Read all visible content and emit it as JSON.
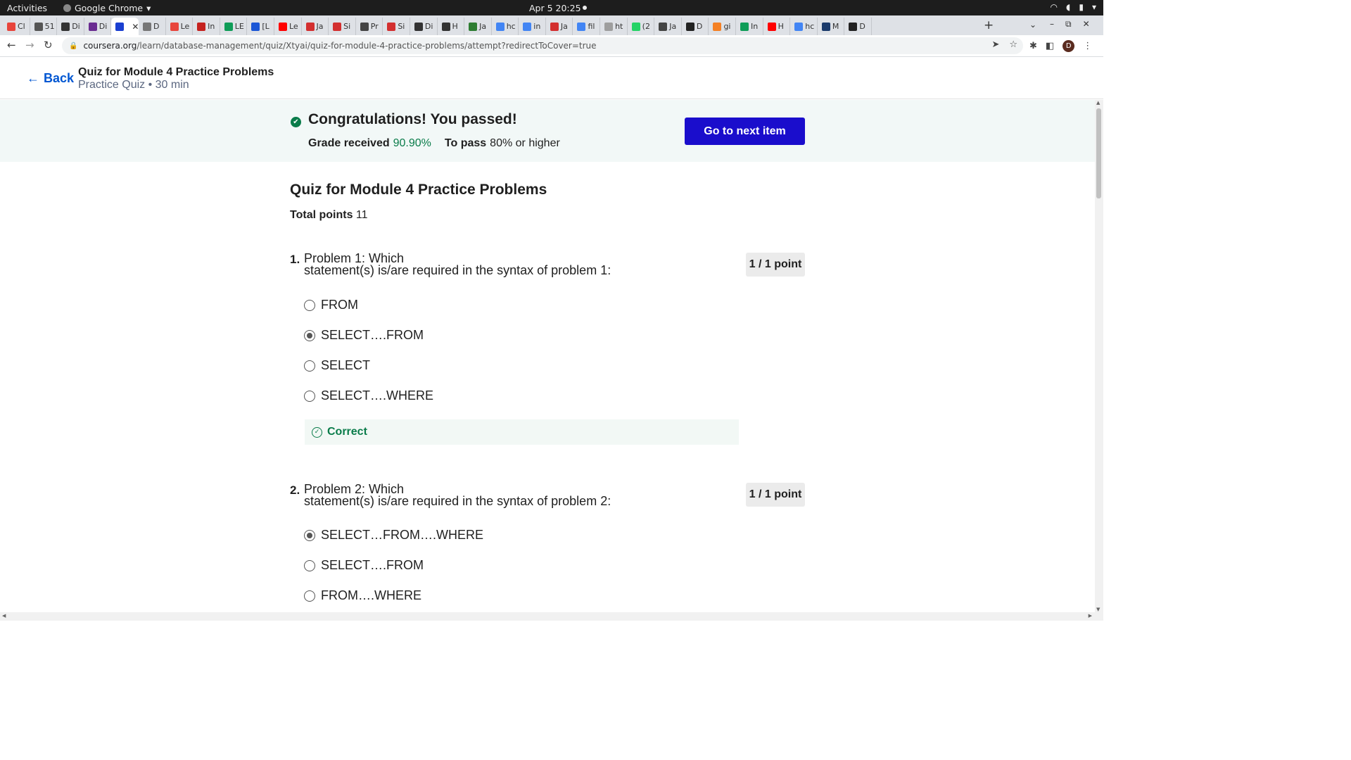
{
  "os": {
    "activities": "Activities",
    "app_name": "Google Chrome",
    "clock": "Apr 5  20:25"
  },
  "tabs": [
    {
      "label": "Cl",
      "color": "#e8453c"
    },
    {
      "label": "51",
      "color": "#555555"
    },
    {
      "label": "Di",
      "color": "#333333"
    },
    {
      "label": "Di",
      "color": "#6a2c91"
    },
    {
      "label": "",
      "color": "#1a3fd1",
      "active": true
    },
    {
      "label": "D",
      "color": "#777777"
    },
    {
      "label": "Le",
      "color": "#e8453c"
    },
    {
      "label": "In",
      "color": "#c5221f"
    },
    {
      "label": "LE",
      "color": "#0f9d58"
    },
    {
      "label": "[L",
      "color": "#1a56d6"
    },
    {
      "label": "Le",
      "color": "#ff0000"
    },
    {
      "label": "Ja",
      "color": "#d32f2f"
    },
    {
      "label": "Si",
      "color": "#d32f2f"
    },
    {
      "label": "Pr",
      "color": "#444444"
    },
    {
      "label": "Si",
      "color": "#d32f2f"
    },
    {
      "label": "Di",
      "color": "#333333"
    },
    {
      "label": "H",
      "color": "#333333"
    },
    {
      "label": "Ja",
      "color": "#2e7d32"
    },
    {
      "label": "hc",
      "color": "#4285f4"
    },
    {
      "label": "in",
      "color": "#4285f4"
    },
    {
      "label": "Ja",
      "color": "#d32f2f"
    },
    {
      "label": "fil",
      "color": "#4285f4"
    },
    {
      "label": "ht",
      "color": "#9e9e9e"
    },
    {
      "label": "(2",
      "color": "#25d366"
    },
    {
      "label": "Ja",
      "color": "#444444"
    },
    {
      "label": "D",
      "color": "#222222"
    },
    {
      "label": "gi",
      "color": "#f48024"
    },
    {
      "label": "In",
      "color": "#0f9d58"
    },
    {
      "label": "H",
      "color": "#ff0000"
    },
    {
      "label": "hc",
      "color": "#4285f4"
    },
    {
      "label": "M",
      "color": "#1a3a6b"
    },
    {
      "label": "D",
      "color": "#222222"
    }
  ],
  "address": {
    "host": "coursera.org",
    "path": "/learn/database-management/quiz/Xtyai/quiz-for-module-4-practice-problems/attempt?redirectToCover=true"
  },
  "profile_initial": "D",
  "header": {
    "back_label": "Back",
    "title": "Quiz for Module 4 Practice Problems",
    "subtitle": "Practice Quiz • 30 min"
  },
  "banner": {
    "title": "Congratulations! You passed!",
    "grade_label": "Grade received",
    "grade_value": "90.90%",
    "pass_label": "To pass",
    "pass_value": "80% or higher",
    "next_button": "Go to next item"
  },
  "quiz": {
    "title": "Quiz for Module 4 Practice Problems",
    "total_label": "Total points",
    "total_value": "11"
  },
  "questions": [
    {
      "number": "1.",
      "line1": "Problem 1: Which",
      "line2": "statement(s) is/are required in the syntax of problem 1:",
      "points": "1 / 1 point",
      "options": [
        "FROM",
        "SELECT….FROM",
        "SELECT",
        "SELECT….WHERE"
      ],
      "selected_index": 1,
      "feedback": "Correct"
    },
    {
      "number": "2.",
      "line1": "Problem 2: Which",
      "line2": "statement(s) is/are required in the syntax of problem 2:",
      "points": "1 / 1 point",
      "options": [
        "SELECT…FROM….WHERE",
        "SELECT….FROM",
        "FROM….WHERE"
      ],
      "selected_index": 0
    }
  ]
}
